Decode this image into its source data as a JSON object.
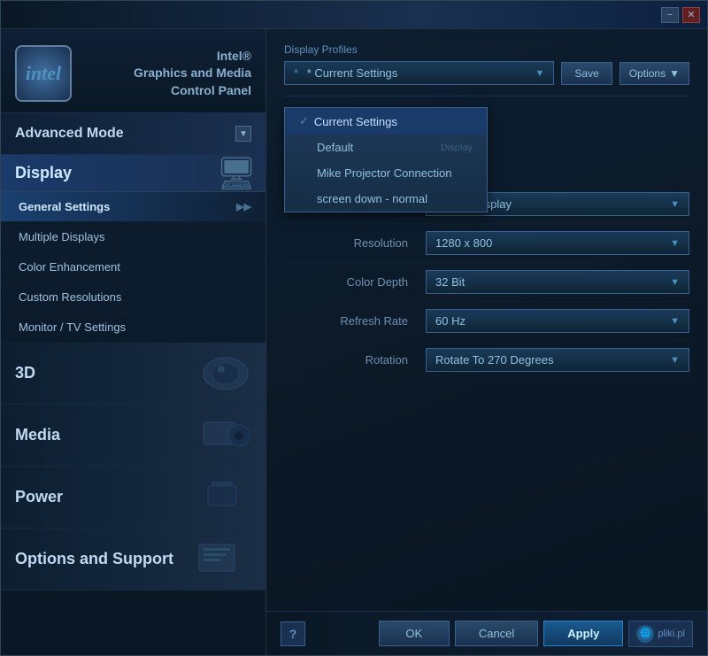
{
  "window": {
    "title": "Intel Graphics and Media Control Panel",
    "titlebar": {
      "minimize": "−",
      "close": "✕"
    }
  },
  "sidebar": {
    "logo": "intel",
    "app_title_line1": "Intel®",
    "app_title_line2": "Graphics and Media",
    "app_title_line3": "Control Panel",
    "mode_label": "Advanced Mode",
    "sections": [
      {
        "id": "display",
        "label": "Display",
        "nav_items": [
          {
            "label": "General Settings",
            "active": true
          },
          {
            "label": "Multiple Displays"
          },
          {
            "label": "Color Enhancement"
          },
          {
            "label": "Custom Resolutions"
          },
          {
            "label": "Monitor / TV Settings"
          }
        ]
      },
      {
        "id": "3d",
        "label": "3D"
      },
      {
        "id": "media",
        "label": "Media"
      },
      {
        "id": "power",
        "label": "Power"
      },
      {
        "id": "options",
        "label": "Options and Support"
      }
    ]
  },
  "right_panel": {
    "profiles": {
      "label": "Display Profiles",
      "current": "* Current Settings",
      "save_btn": "Save",
      "options_btn": "Options",
      "dropdown_items": [
        {
          "label": "Current Settings",
          "selected": true
        },
        {
          "label": "Default"
        },
        {
          "label": "Mike Projector Connection"
        },
        {
          "label": "screen down - normal"
        }
      ]
    },
    "settings": [
      {
        "label": "Display",
        "value": "Built-in Display"
      },
      {
        "label": "Resolution",
        "value": "1280 x 800"
      },
      {
        "label": "Color Depth",
        "value": "32 Bit"
      },
      {
        "label": "Refresh Rate",
        "value": "60 Hz"
      },
      {
        "label": "Rotation",
        "value": "Rotate To 270 Degrees"
      }
    ]
  },
  "bottom": {
    "help": "?",
    "ok": "OK",
    "cancel": "Cancel",
    "apply": "Apply",
    "badge": "pliki.pl"
  }
}
